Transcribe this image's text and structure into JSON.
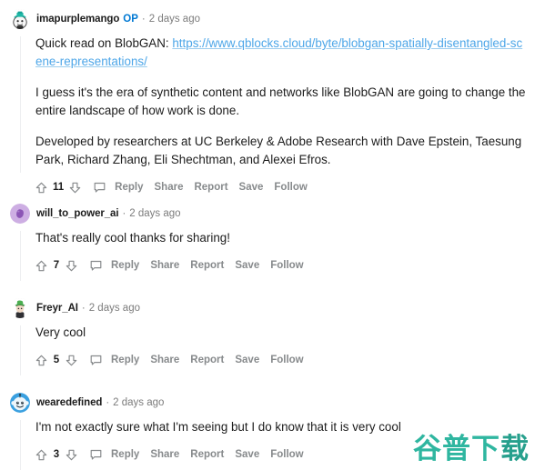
{
  "watermark": {
    "text_main": "谷普下",
    "text_tail": "载"
  },
  "colors": {
    "link": "#4da6e8",
    "op_badge": "#0079d3",
    "meta_text": "#7c7c7c",
    "action_text": "#878a8c",
    "body_text": "#1c1c1c",
    "thread_line": "#edeff1",
    "watermark": "#2fb6a0"
  },
  "actions_labels": {
    "reply": "Reply",
    "share": "Share",
    "report": "Report",
    "save": "Save",
    "follow": "Follow"
  },
  "comments": [
    {
      "id": "comment-1",
      "user": "imapurplemango",
      "op_badge": "OP",
      "separator": "·",
      "time": "2 days ago",
      "avatar": "snoo-teal-hat-avatar",
      "score": "11",
      "paragraphs": [
        {
          "pre": "Quick read on BlobGAN: ",
          "link": "https://www.qblocks.cloud/byte/blobgan-spatially-disentangled-scene-representations/",
          "post": ""
        },
        {
          "pre": "I guess it's the era of synthetic content and networks like BlobGAN are going to change the entire landscape of how work is done."
        },
        {
          "pre": "Developed by researchers at UC Berkeley & Adobe Research with Dave Epstein, Taesung Park, Richard Zhang, Eli Shechtman, and Alexei Efros."
        }
      ]
    },
    {
      "id": "comment-2",
      "user": "will_to_power_ai",
      "op_badge": "",
      "separator": "·",
      "time": "2 days ago",
      "avatar": "purple-blob-avatar",
      "score": "7",
      "paragraphs": [
        {
          "pre": "That's really cool thanks for sharing!"
        }
      ]
    },
    {
      "id": "comment-3",
      "user": "Freyr_AI",
      "op_badge": "",
      "separator": "·",
      "time": "2 days ago",
      "avatar": "green-hat-character-avatar",
      "score": "5",
      "paragraphs": [
        {
          "pre": "Very cool"
        }
      ]
    },
    {
      "id": "comment-4",
      "user": "wearedefined",
      "op_badge": "",
      "separator": "·",
      "time": "2 days ago",
      "avatar": "blue-snoo-avatar",
      "score": "3",
      "paragraphs": [
        {
          "pre": "I'm not exactly sure what I'm seeing but I do know that it is very cool"
        }
      ]
    }
  ]
}
